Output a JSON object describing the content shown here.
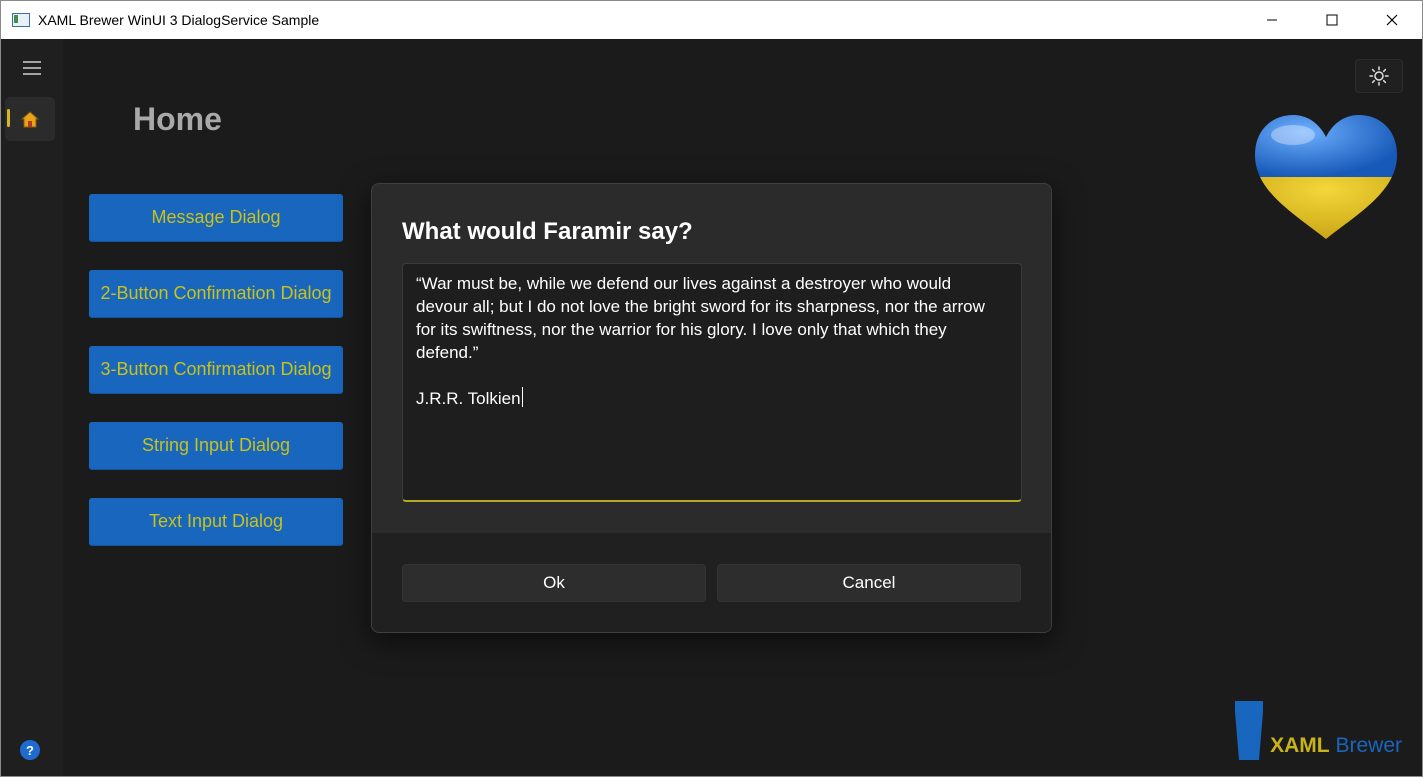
{
  "window": {
    "title": "XAML Brewer WinUI 3 DialogService Sample"
  },
  "nav": {
    "items": [
      {
        "name": "home",
        "icon": "home-icon",
        "selected": true
      }
    ],
    "accent_color": "#d7b722"
  },
  "page": {
    "title": "Home"
  },
  "buttons": [
    {
      "label": "Message Dialog"
    },
    {
      "label": "2-Button Confirmation Dialog"
    },
    {
      "label": "3-Button Confirmation Dialog"
    },
    {
      "label": "String Input Dialog"
    },
    {
      "label": "Text Input Dialog"
    }
  ],
  "dialog": {
    "title": "What would Faramir say?",
    "text_lines": [
      "“War must be, while we defend our lives against a destroyer who would",
      "devour all; but I do not love the bright sword for its sharpness, nor the arrow",
      "for its swiftness, nor the warrior for his glory. I love only that which they",
      "defend.”"
    ],
    "author": "J.R.R. Tolkien",
    "ok_label": "Ok",
    "cancel_label": "Cancel"
  },
  "brand": {
    "name_part1": "XAML",
    "name_part2": "Brewer"
  },
  "colors": {
    "button_bg": "#1866bd",
    "button_text": "#c8c21a",
    "heart_top": "#1f6fd0",
    "heart_bottom": "#e3c21a"
  }
}
